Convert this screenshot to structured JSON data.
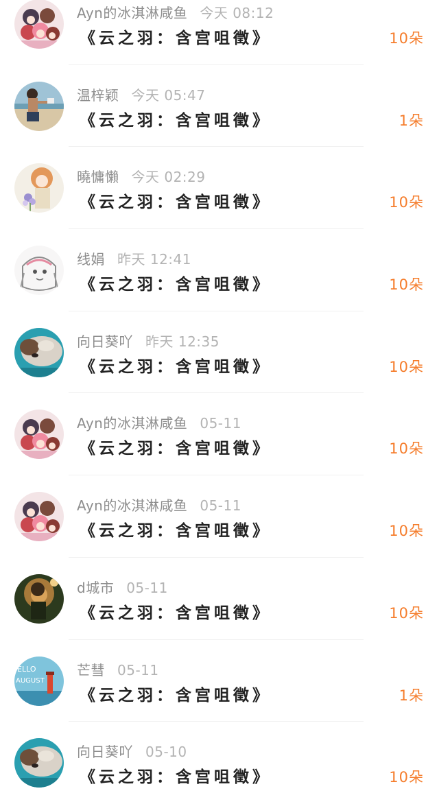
{
  "accent_color": "#f57d2c",
  "rows": [
    {
      "avatar_icon": "group-girls-avatar-icon",
      "user": "Ayn的冰淇淋咸鱼",
      "time": "今天 08:12",
      "book": "《云之羽：含宫咀徵》",
      "gift": "10朵"
    },
    {
      "avatar_icon": "beach-person-avatar-icon",
      "user": "温梓颖",
      "time": "今天 05:47",
      "book": "《云之羽：含宫咀徵》",
      "gift": "1朵"
    },
    {
      "avatar_icon": "flower-girl-avatar-icon",
      "user": "曉慵懶",
      "time": "今天 02:29",
      "book": "《云之羽：含宫咀徵》",
      "gift": "10朵"
    },
    {
      "avatar_icon": "sketch-girl-avatar-icon",
      "user": "线娟",
      "time": "昨天 12:41",
      "book": "《云之羽：含宫咀徵》",
      "gift": "10朵"
    },
    {
      "avatar_icon": "sleeping-dog-avatar-icon",
      "user": "向日葵吖",
      "time": "昨天 12:35",
      "book": "《云之羽：含宫咀徵》",
      "gift": "10朵"
    },
    {
      "avatar_icon": "group-girls-avatar-icon",
      "user": "Ayn的冰淇淋咸鱼",
      "time": "05-11",
      "book": "《云之羽：含宫咀徵》",
      "gift": "10朵"
    },
    {
      "avatar_icon": "group-girls-avatar-icon",
      "user": "Ayn的冰淇淋咸鱼",
      "time": "05-11",
      "book": "《云之羽：含宫咀徵》",
      "gift": "10朵"
    },
    {
      "avatar_icon": "sunset-girl-avatar-icon",
      "user": "d城市",
      "time": "05-11",
      "book": "《云之羽：含宫咀徵》",
      "gift": "10朵"
    },
    {
      "avatar_icon": "hello-august-avatar-icon",
      "user": "芒彗",
      "time": "05-11",
      "book": "《云之羽：含宫咀徵》",
      "gift": "1朵",
      "avatar_text_1": "ELLO",
      "avatar_text_2": "AUGUST"
    },
    {
      "avatar_icon": "sleeping-dog-avatar-icon",
      "user": "向日葵吖",
      "time": "05-10",
      "book": "《云之羽：含宫咀徵》",
      "gift": "10朵"
    }
  ]
}
